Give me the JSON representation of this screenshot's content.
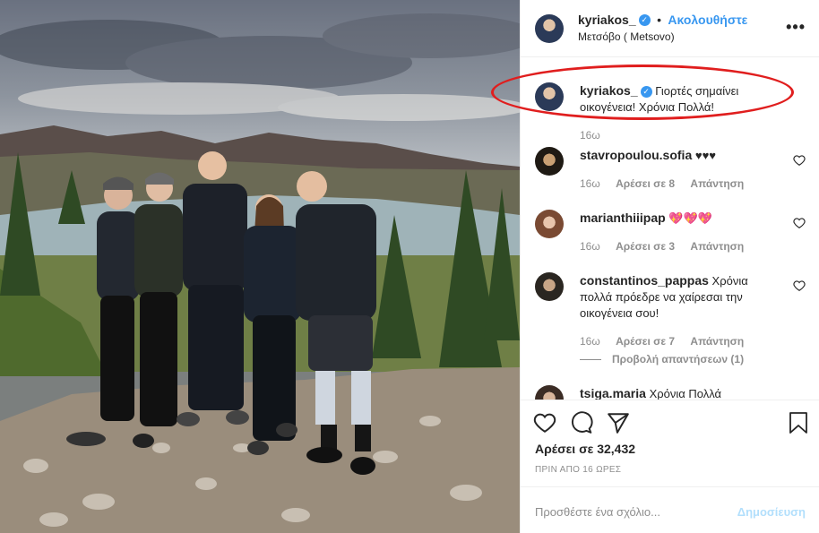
{
  "post": {
    "username": "kyriakos_",
    "follow_label": "Ακολουθήστε",
    "dot": "•",
    "location": "Μετσόβο ( Metsovo)",
    "more_label": "•••",
    "caption_user": "kyriakos_",
    "caption_text": "Γιορτές σημαίνει οικογένεια! Χρόνια Πολλά!",
    "caption_time": "16ω",
    "likes": "Αρέσει σε 32,432",
    "post_time": "ΠΡΙΝ ΑΠΟ 16 ΩΡΕΣ",
    "add_comment_placeholder": "Προσθέστε ένα σχόλιο...",
    "publish_label": "Δημοσίευση"
  },
  "comments": [
    {
      "user": "stavropoulou.sofia",
      "text": "♥♥♥",
      "time": "16ω",
      "likes": "Αρέσει σε 8",
      "reply": "Απάντηση"
    },
    {
      "user": "marianthiiipap",
      "text": "💖💖💖",
      "time": "16ω",
      "likes": "Αρέσει σε 3",
      "reply": "Απάντηση"
    },
    {
      "user": "constantinos_pappas",
      "text": "Χρόνια πολλά πρόεδρε να χαίρεσαι την οικογένεια σου!",
      "time": "16ω",
      "likes": "Αρέσει σε 7",
      "reply": "Απάντηση",
      "view_replies": "Προβολή απαντήσεων (1)"
    },
    {
      "user": "tsiga.maria",
      "text": "Χρόνια Πολλά"
    }
  ],
  "colors": {
    "accent": "#3897f0",
    "annotation": "#e01e1e",
    "muted": "#8e8e8e"
  },
  "icons": [
    "heart-icon",
    "comment-icon",
    "share-icon",
    "bookmark-icon",
    "verified-badge-icon",
    "more-options-icon"
  ]
}
